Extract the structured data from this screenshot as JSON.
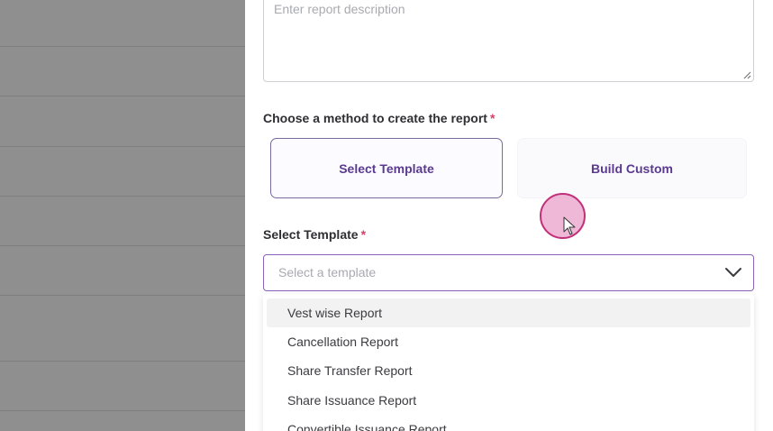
{
  "description": {
    "placeholder": "Enter report description"
  },
  "method": {
    "label": "Choose a method to create the report",
    "required_marker": "*",
    "options": [
      {
        "label": "Select Template",
        "selected": true
      },
      {
        "label": "Build Custom",
        "selected": false
      }
    ]
  },
  "template": {
    "label": "Select Template",
    "required_marker": "*",
    "placeholder": "Select a template",
    "dropdown_icon": "chevron-down-icon",
    "options": [
      {
        "label": "Vest wise Report",
        "highlighted": true
      },
      {
        "label": "Cancellation Report",
        "highlighted": false
      },
      {
        "label": "Share Transfer Report",
        "highlighted": false
      },
      {
        "label": "Share Issuance Report",
        "highlighted": false
      },
      {
        "label": "Convertible Issuance Report",
        "highlighted": false
      }
    ]
  },
  "colors": {
    "accent": "#5b3a8f",
    "required": "#d9406a",
    "focus_border": "#8a62b8",
    "overlay": "#8f8f8f",
    "cursor_ring": "#c2307a"
  }
}
